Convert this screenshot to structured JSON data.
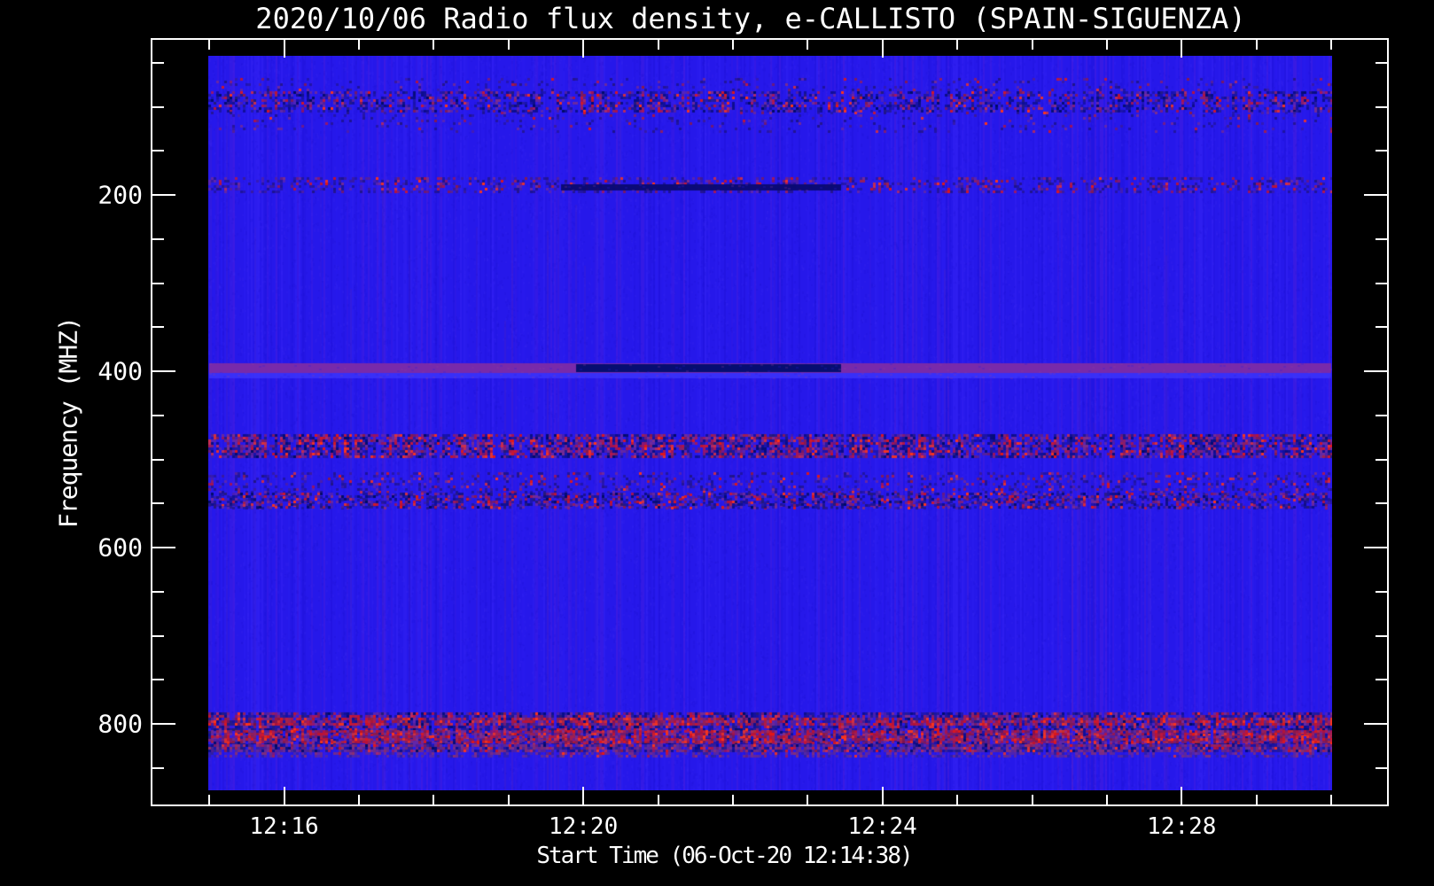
{
  "figure": {
    "title": "2020/10/06  Radio flux density, e-CALLISTO (SPAIN-SIGUENZA)",
    "xlabel": "Start Time (06-Oct-20 12:14:38)",
    "ylabel": "Frequency (MHZ)",
    "background_color": "#000000",
    "foreground_color": "#ffffff",
    "instrument": "e-CALLISTO (SPAIN-SIGUENZA)",
    "date": "2020/10/06",
    "start_time": "12:14:38"
  },
  "chart_data": {
    "type": "heatmap",
    "subtype": "radio-spectrogram",
    "title": "2020/10/06  Radio flux density, e-CALLISTO (SPAIN-SIGUENZA)",
    "xlabel": "Start Time (06-Oct-20 12:14:38)",
    "ylabel": "Frequency (MHZ)",
    "grid": false,
    "legend": "none",
    "x_axis": {
      "unit": "time (HH:MM)",
      "major_ticks": [
        {
          "label": "12:16",
          "minute": 16
        },
        {
          "label": "12:20",
          "minute": 20
        },
        {
          "label": "12:24",
          "minute": 24
        },
        {
          "label": "12:28",
          "minute": 28
        }
      ],
      "minor_tick_minutes": [
        15,
        17,
        18,
        19,
        21,
        22,
        23,
        25,
        26,
        27,
        29,
        30
      ],
      "data_extent_minutes": [
        15,
        30
      ]
    },
    "y_axis": {
      "unit": "MHz",
      "major_ticks": [
        {
          "label": "200",
          "mhz": 200
        },
        {
          "label": "400",
          "mhz": 400
        },
        {
          "label": "600",
          "mhz": 600
        },
        {
          "label": "800",
          "mhz": 800
        }
      ],
      "minor_tick_mhz": [
        50,
        100,
        150,
        250,
        300,
        350,
        450,
        500,
        550,
        650,
        700,
        750,
        850
      ],
      "data_extent_mhz": [
        45,
        870
      ],
      "direction": "increasing-downward"
    },
    "background": {
      "base_color": "#2618ea",
      "striation_colors": [
        "#1d10d6",
        "#2c1ef4",
        "#3a28f8",
        "#5a20d8"
      ],
      "warm_streak_color": "#a03068"
    },
    "noise_bands": [
      {
        "id": "band-90mhz",
        "f_mhz": [
          82,
          106
        ],
        "density": 0.55,
        "red_bias": 0.28,
        "palette": "dark_mix"
      },
      {
        "id": "band-75mhz-halo",
        "f_mhz": [
          67,
          82
        ],
        "density": 0.12,
        "red_bias": 0.2,
        "palette": "subtle"
      },
      {
        "id": "band-118mhz-halo",
        "f_mhz": [
          106,
          130
        ],
        "density": 0.1,
        "red_bias": 0.2,
        "palette": "subtle"
      },
      {
        "id": "band-190mhz",
        "f_mhz": [
          180,
          197
        ],
        "density": 0.38,
        "red_bias": 0.3,
        "palette": "subtle"
      },
      {
        "id": "band-480mhz",
        "f_mhz": [
          471,
          496
        ],
        "density": 0.85,
        "red_bias": 0.4,
        "palette": "dark_mix"
      },
      {
        "id": "band-535mhz",
        "f_mhz": [
          515,
          557
        ],
        "density": 0.28,
        "red_bias": 0.22,
        "palette": "subtle"
      },
      {
        "id": "band-548mhz",
        "f_mhz": [
          538,
          555
        ],
        "density": 0.5,
        "red_bias": 0.28,
        "palette": "dark_mix"
      },
      {
        "id": "band-810mhz",
        "f_mhz": [
          787,
          831
        ],
        "density": 0.92,
        "red_bias": 0.3,
        "palette": "dark_mix"
      },
      {
        "id": "band-797mhz-red",
        "f_mhz": [
          793,
          802
        ],
        "density": 0.72,
        "red_bias": 0.8,
        "palette": "red_strong"
      },
      {
        "id": "band-814mhz-red",
        "f_mhz": [
          807,
          821
        ],
        "density": 0.78,
        "red_bias": 0.85,
        "palette": "red_strong"
      },
      {
        "id": "band-829mhz-fade",
        "f_mhz": [
          823,
          836
        ],
        "density": 0.5,
        "red_bias": 0.1,
        "palette": "purple_fade"
      }
    ],
    "features": [
      {
        "id": "carrier-line-400mhz",
        "f_mhz": [
          391,
          402
        ],
        "t_minutes": [
          15,
          30
        ],
        "color": "#7c2ba6",
        "kind": "continuous purple line"
      },
      {
        "id": "bright-row-405mhz",
        "f_mhz": [
          402,
          408
        ],
        "t_minutes": [
          15,
          30
        ],
        "color": "#3c34fa",
        "kind": "bright blue row"
      },
      {
        "id": "dark-segment-400mhz",
        "f_mhz": [
          392,
          401
        ],
        "t_minutes": [
          19.9,
          23.45
        ],
        "color": "#000d6e",
        "kind": "dark dropout segment"
      },
      {
        "id": "dark-segment-192mhz",
        "f_mhz": [
          188,
          195
        ],
        "t_minutes": [
          19.7,
          23.45
        ],
        "color": "#0a0a72",
        "kind": "dark dropout segment"
      }
    ],
    "palettes": {
      "dark_mix": [
        "#000a66",
        "#0d0d8a",
        "#1b149c",
        "#241a78"
      ],
      "subtle": [
        "#1c128f",
        "#3a1a9a",
        "#24148c",
        "#201488"
      ],
      "red_strong": [
        "#e21717",
        "#ff3517",
        "#c01330",
        "#000a60"
      ],
      "purple_fade": [
        "#5a2a9c",
        "#6a2a8c",
        "#3020a0",
        "#8a3070"
      ],
      "warm": [
        "#e21717",
        "#ff3517",
        "#c01330",
        "#8a1a4a",
        "#a02050"
      ],
      "purple": [
        "#6a28a0",
        "#55209a",
        "#802e88"
      ]
    }
  }
}
